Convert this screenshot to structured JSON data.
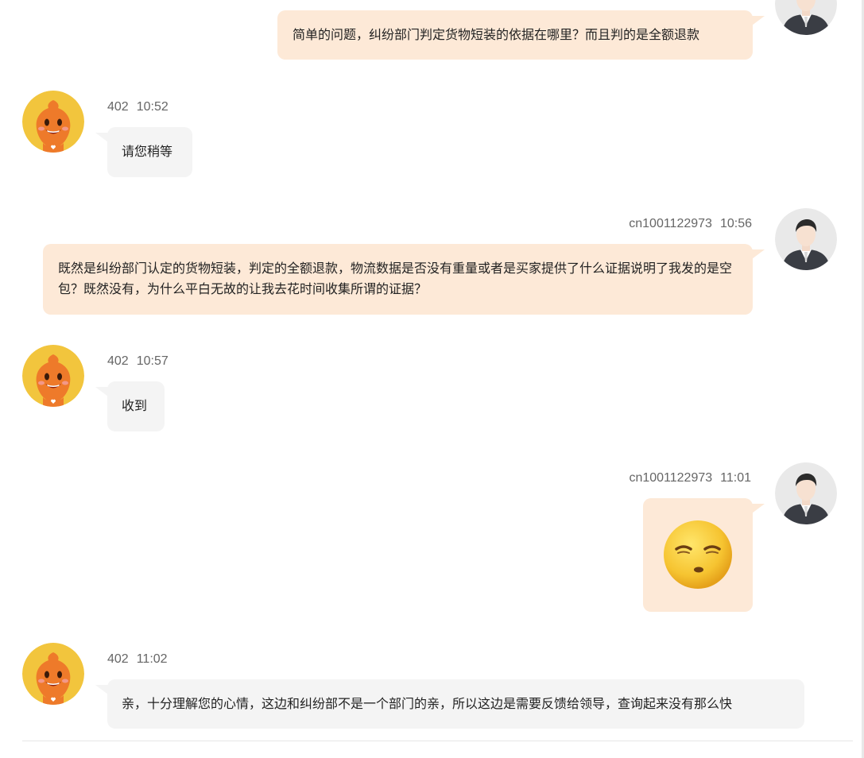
{
  "colors": {
    "agent_bubble": "#f4f4f4",
    "user_bubble": "#fde9d7",
    "meta_text": "#666666"
  },
  "icons": {
    "agent_avatar": "orange-mascot-avatar",
    "user_avatar": "man-in-suit-avatar",
    "emoji": "sleepy-face-emoji"
  },
  "messages": [
    {
      "sender": "user",
      "text": "简单的问题，纠纷部门判定货物短装的依据在哪里？而且判的是全额退款"
    },
    {
      "sender": "agent",
      "name": "402",
      "time": "10:52",
      "text": "请您稍等"
    },
    {
      "sender": "user",
      "name": "cn1001122973",
      "time": "10:56",
      "text": "既然是纠纷部门认定的货物短装，判定的全额退款，物流数据是否没有重量或者是买家提供了什么证据说明了我发的是空包？既然没有，为什么平白无故的让我去花时间收集所谓的证据？"
    },
    {
      "sender": "agent",
      "name": "402",
      "time": "10:57",
      "text": "收到"
    },
    {
      "sender": "user",
      "name": "cn1001122973",
      "time": "11:01",
      "emoji": "sleepy-face-emoji"
    },
    {
      "sender": "agent",
      "name": "402",
      "time": "11:02",
      "text": "亲，十分理解您的心情，这边和纠纷部不是一个部门的亲，所以这边是需要反馈给领导，查询起来没有那么快"
    }
  ]
}
